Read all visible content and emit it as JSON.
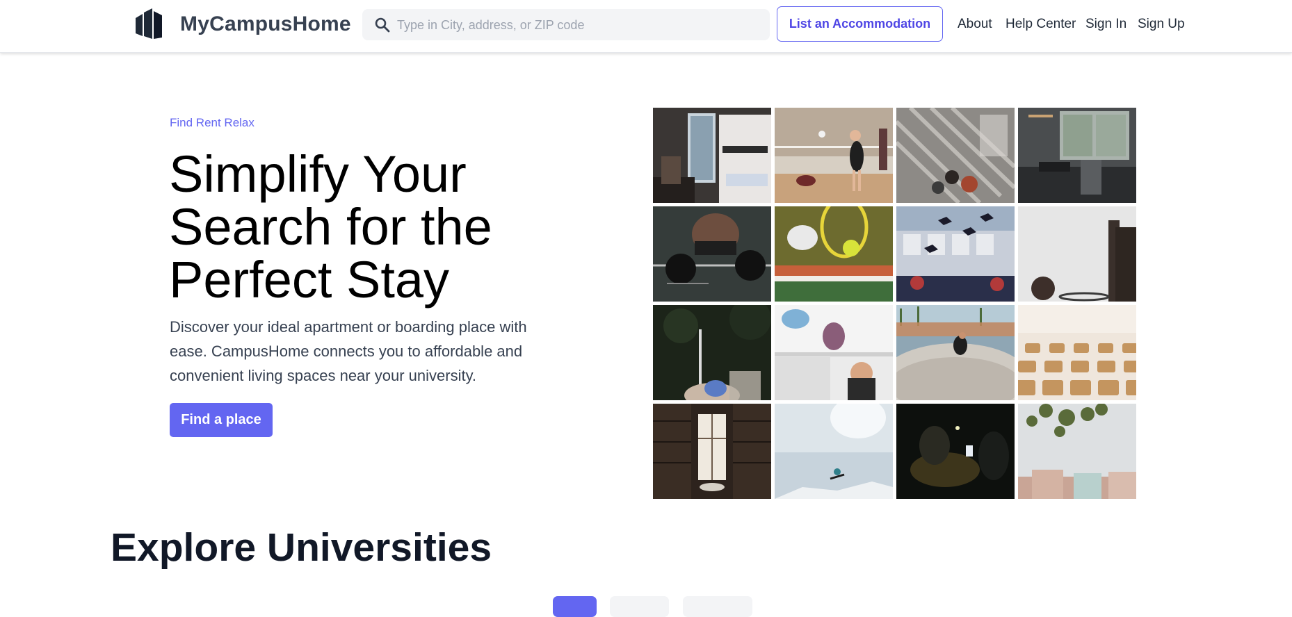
{
  "brand": {
    "name": "MyCampusHome",
    "logo_icon": "building-logo-icon"
  },
  "search": {
    "placeholder": "Type in City, address, or ZIP code",
    "value": "",
    "icon": "search-icon"
  },
  "header": {
    "cta_label": "List an Accommodation",
    "nav": [
      {
        "label": "About"
      },
      {
        "label": "Help Center"
      },
      {
        "label": "Sign In"
      },
      {
        "label": "Sign Up"
      }
    ]
  },
  "hero": {
    "tagline": "Find Rent Relax",
    "title": "Simplify Your Search for the Perfect Stay",
    "description": "Discover your ideal apartment or boarding place with ease. CampusHome connects you to affordable and convenient living spaces near your university.",
    "cta_label": "Find a place"
  },
  "gallery": {
    "photos": [
      "dorm-bunk-bed-photo",
      "volleyball-game-photo",
      "campus-stairs-photo",
      "study-desk-window-photo",
      "weightlifting-barbell-photo",
      "tennis-ball-racket-photo",
      "graduation-caps-photo",
      "basketball-hoop-photo",
      "fencing-sport-photo",
      "students-dorm-room-photo",
      "skatepark-photo",
      "auditorium-seats-photo",
      "library-window-photo",
      "snowboard-jump-photo",
      "night-phone-glow-photo",
      "campus-building-tree-photo"
    ]
  },
  "explore": {
    "title": "Explore Universities",
    "tabs": [
      {
        "name": "filter-tab-1",
        "active": true
      },
      {
        "name": "filter-tab-2",
        "active": false
      },
      {
        "name": "filter-tab-3",
        "active": false
      }
    ]
  },
  "colors": {
    "accent": "#6366f1",
    "accent_dark": "#4f46e5",
    "text_dark": "#111827",
    "text_muted": "#374151",
    "search_bg": "#f3f4f6"
  }
}
